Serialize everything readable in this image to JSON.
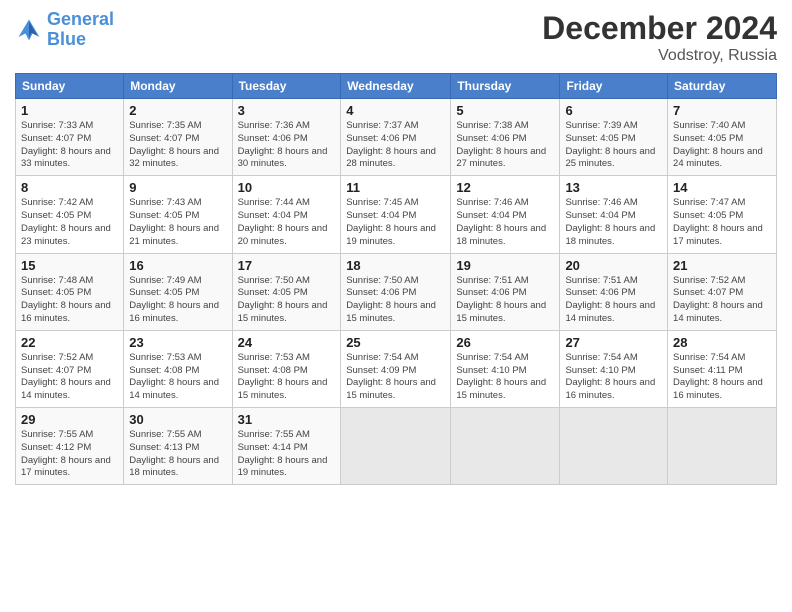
{
  "header": {
    "logo_line1": "General",
    "logo_line2": "Blue",
    "month": "December 2024",
    "location": "Vodstroy, Russia"
  },
  "weekdays": [
    "Sunday",
    "Monday",
    "Tuesday",
    "Wednesday",
    "Thursday",
    "Friday",
    "Saturday"
  ],
  "weeks": [
    [
      {
        "day": "1",
        "sunrise": "Sunrise: 7:33 AM",
        "sunset": "Sunset: 4:07 PM",
        "daylight": "Daylight: 8 hours and 33 minutes."
      },
      {
        "day": "2",
        "sunrise": "Sunrise: 7:35 AM",
        "sunset": "Sunset: 4:07 PM",
        "daylight": "Daylight: 8 hours and 32 minutes."
      },
      {
        "day": "3",
        "sunrise": "Sunrise: 7:36 AM",
        "sunset": "Sunset: 4:06 PM",
        "daylight": "Daylight: 8 hours and 30 minutes."
      },
      {
        "day": "4",
        "sunrise": "Sunrise: 7:37 AM",
        "sunset": "Sunset: 4:06 PM",
        "daylight": "Daylight: 8 hours and 28 minutes."
      },
      {
        "day": "5",
        "sunrise": "Sunrise: 7:38 AM",
        "sunset": "Sunset: 4:06 PM",
        "daylight": "Daylight: 8 hours and 27 minutes."
      },
      {
        "day": "6",
        "sunrise": "Sunrise: 7:39 AM",
        "sunset": "Sunset: 4:05 PM",
        "daylight": "Daylight: 8 hours and 25 minutes."
      },
      {
        "day": "7",
        "sunrise": "Sunrise: 7:40 AM",
        "sunset": "Sunset: 4:05 PM",
        "daylight": "Daylight: 8 hours and 24 minutes."
      }
    ],
    [
      {
        "day": "8",
        "sunrise": "Sunrise: 7:42 AM",
        "sunset": "Sunset: 4:05 PM",
        "daylight": "Daylight: 8 hours and 23 minutes."
      },
      {
        "day": "9",
        "sunrise": "Sunrise: 7:43 AM",
        "sunset": "Sunset: 4:05 PM",
        "daylight": "Daylight: 8 hours and 21 minutes."
      },
      {
        "day": "10",
        "sunrise": "Sunrise: 7:44 AM",
        "sunset": "Sunset: 4:04 PM",
        "daylight": "Daylight: 8 hours and 20 minutes."
      },
      {
        "day": "11",
        "sunrise": "Sunrise: 7:45 AM",
        "sunset": "Sunset: 4:04 PM",
        "daylight": "Daylight: 8 hours and 19 minutes."
      },
      {
        "day": "12",
        "sunrise": "Sunrise: 7:46 AM",
        "sunset": "Sunset: 4:04 PM",
        "daylight": "Daylight: 8 hours and 18 minutes."
      },
      {
        "day": "13",
        "sunrise": "Sunrise: 7:46 AM",
        "sunset": "Sunset: 4:04 PM",
        "daylight": "Daylight: 8 hours and 18 minutes."
      },
      {
        "day": "14",
        "sunrise": "Sunrise: 7:47 AM",
        "sunset": "Sunset: 4:05 PM",
        "daylight": "Daylight: 8 hours and 17 minutes."
      }
    ],
    [
      {
        "day": "15",
        "sunrise": "Sunrise: 7:48 AM",
        "sunset": "Sunset: 4:05 PM",
        "daylight": "Daylight: 8 hours and 16 minutes."
      },
      {
        "day": "16",
        "sunrise": "Sunrise: 7:49 AM",
        "sunset": "Sunset: 4:05 PM",
        "daylight": "Daylight: 8 hours and 16 minutes."
      },
      {
        "day": "17",
        "sunrise": "Sunrise: 7:50 AM",
        "sunset": "Sunset: 4:05 PM",
        "daylight": "Daylight: 8 hours and 15 minutes."
      },
      {
        "day": "18",
        "sunrise": "Sunrise: 7:50 AM",
        "sunset": "Sunset: 4:06 PM",
        "daylight": "Daylight: 8 hours and 15 minutes."
      },
      {
        "day": "19",
        "sunrise": "Sunrise: 7:51 AM",
        "sunset": "Sunset: 4:06 PM",
        "daylight": "Daylight: 8 hours and 15 minutes."
      },
      {
        "day": "20",
        "sunrise": "Sunrise: 7:51 AM",
        "sunset": "Sunset: 4:06 PM",
        "daylight": "Daylight: 8 hours and 14 minutes."
      },
      {
        "day": "21",
        "sunrise": "Sunrise: 7:52 AM",
        "sunset": "Sunset: 4:07 PM",
        "daylight": "Daylight: 8 hours and 14 minutes."
      }
    ],
    [
      {
        "day": "22",
        "sunrise": "Sunrise: 7:52 AM",
        "sunset": "Sunset: 4:07 PM",
        "daylight": "Daylight: 8 hours and 14 minutes."
      },
      {
        "day": "23",
        "sunrise": "Sunrise: 7:53 AM",
        "sunset": "Sunset: 4:08 PM",
        "daylight": "Daylight: 8 hours and 14 minutes."
      },
      {
        "day": "24",
        "sunrise": "Sunrise: 7:53 AM",
        "sunset": "Sunset: 4:08 PM",
        "daylight": "Daylight: 8 hours and 15 minutes."
      },
      {
        "day": "25",
        "sunrise": "Sunrise: 7:54 AM",
        "sunset": "Sunset: 4:09 PM",
        "daylight": "Daylight: 8 hours and 15 minutes."
      },
      {
        "day": "26",
        "sunrise": "Sunrise: 7:54 AM",
        "sunset": "Sunset: 4:10 PM",
        "daylight": "Daylight: 8 hours and 15 minutes."
      },
      {
        "day": "27",
        "sunrise": "Sunrise: 7:54 AM",
        "sunset": "Sunset: 4:10 PM",
        "daylight": "Daylight: 8 hours and 16 minutes."
      },
      {
        "day": "28",
        "sunrise": "Sunrise: 7:54 AM",
        "sunset": "Sunset: 4:11 PM",
        "daylight": "Daylight: 8 hours and 16 minutes."
      }
    ],
    [
      {
        "day": "29",
        "sunrise": "Sunrise: 7:55 AM",
        "sunset": "Sunset: 4:12 PM",
        "daylight": "Daylight: 8 hours and 17 minutes."
      },
      {
        "day": "30",
        "sunrise": "Sunrise: 7:55 AM",
        "sunset": "Sunset: 4:13 PM",
        "daylight": "Daylight: 8 hours and 18 minutes."
      },
      {
        "day": "31",
        "sunrise": "Sunrise: 7:55 AM",
        "sunset": "Sunset: 4:14 PM",
        "daylight": "Daylight: 8 hours and 19 minutes."
      },
      null,
      null,
      null,
      null
    ]
  ]
}
